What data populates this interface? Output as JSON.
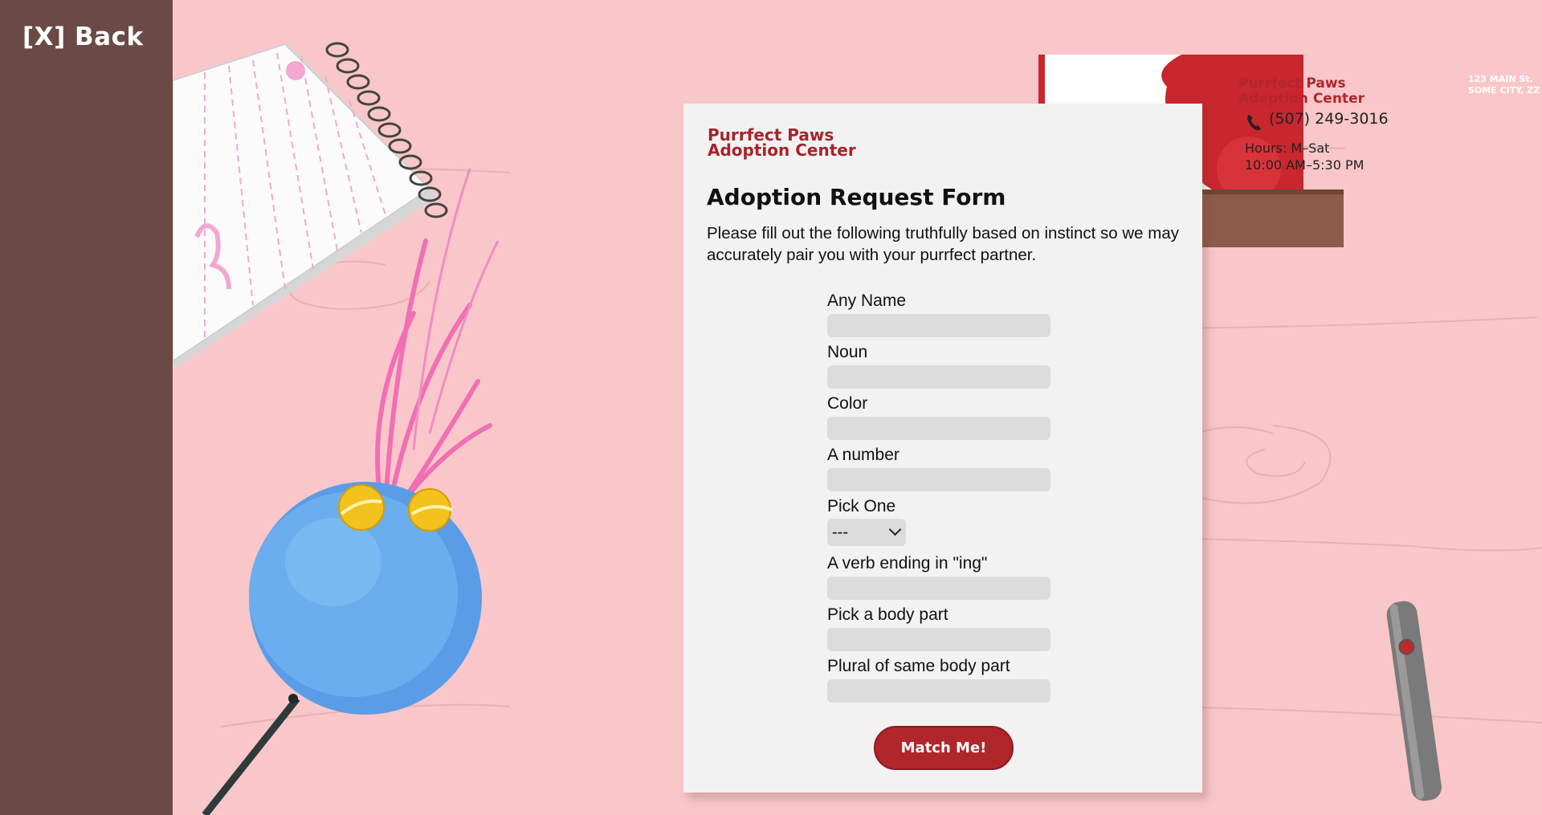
{
  "nav": {
    "back_label": "[X] Back"
  },
  "business_card": {
    "name": "Purrfect Paws\nAdoption Center",
    "address": "123 MAIN St.\nSOME CITY, ZZ",
    "phone": "(507) 249-3016",
    "hours": "Hours: M–Sat\n       10:00 AM–5:30 PM"
  },
  "form": {
    "brand": "Purrfect Paws\nAdoption Center",
    "title": "Adoption Request Form",
    "intro": "Please fill out the following truthfully based on instinct so we may accurately pair you with your purrfect partner.",
    "fields": [
      {
        "label": "Any Name",
        "value": ""
      },
      {
        "label": "Noun",
        "value": ""
      },
      {
        "label": "Color",
        "value": ""
      },
      {
        "label": "A number",
        "value": ""
      },
      {
        "label": "Pick One",
        "selected": "---"
      },
      {
        "label": "A verb ending in \"ing\"",
        "value": ""
      },
      {
        "label": "Pick a body part",
        "value": ""
      },
      {
        "label": "Plural of same body part",
        "value": ""
      }
    ],
    "submit_label": "Match Me!"
  },
  "colors": {
    "sidebar": "#6b4a45",
    "background": "#f9c7c9",
    "accent": "#b1262b"
  },
  "icons": [
    "phone-icon",
    "chevron-down-icon"
  ]
}
